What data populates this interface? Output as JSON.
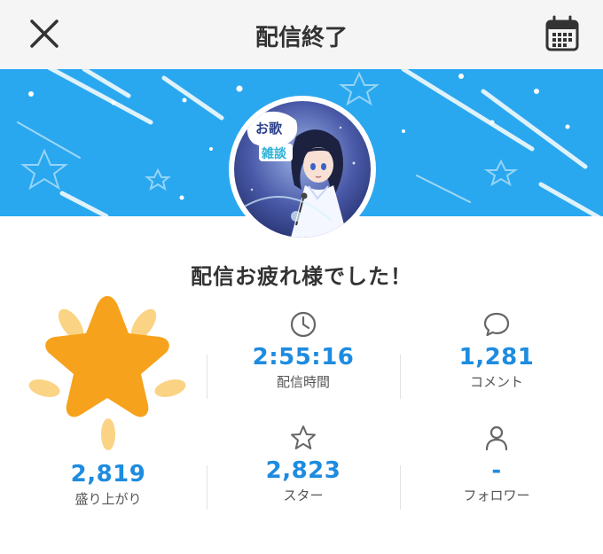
{
  "header": {
    "title": "配信終了",
    "close_icon": "close-icon",
    "calendar_icon": "calendar-icon"
  },
  "banner": {
    "color": "#2aa8ef",
    "avatar_caption_top": "お歌",
    "avatar_caption_bottom": "雑談"
  },
  "message": "配信お疲れ様でした！",
  "stats": {
    "duration": {
      "value": "2:55:16",
      "label": "配信時間",
      "icon": "clock-icon"
    },
    "comments": {
      "value": "1,281",
      "label": "コメント",
      "icon": "comment-icon"
    },
    "excitement": {
      "value": "2,819",
      "label": "盛り上がり",
      "icon": "star-burst-icon"
    },
    "stars": {
      "value": "2,823",
      "label": "スター",
      "icon": "star-outline-icon"
    },
    "followers": {
      "value": "-",
      "label": "フォロワー",
      "icon": "person-icon"
    }
  },
  "colors": {
    "accent": "#1d8ce0",
    "star": "#f7a21c",
    "star_rays": "#fbd384"
  }
}
